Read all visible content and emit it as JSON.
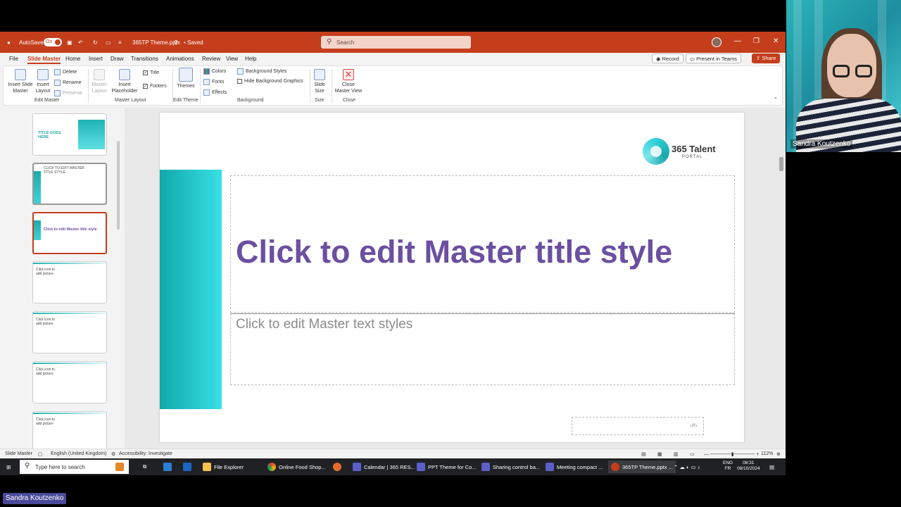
{
  "titlebar": {
    "autosave_label": "AutoSave",
    "autosave_state": "On",
    "filename": "365TP Theme.pptx",
    "saved_status": "• Saved",
    "search_placeholder": "Search"
  },
  "menu": {
    "tabs": [
      "File",
      "Slide Master",
      "Home",
      "Insert",
      "Draw",
      "Transitions",
      "Animations",
      "Review",
      "View",
      "Help"
    ],
    "record": "Record",
    "present_teams": "Present in Teams",
    "share": "Share"
  },
  "ribbon": {
    "insert_slide_master": "Insert Slide Master",
    "insert_layout": "Insert Layout",
    "delete": "Delete",
    "rename": "Rename",
    "preserve": "Preserve",
    "edit_master_group": "Edit Master",
    "master_layout": "Master Layout",
    "insert_placeholder": "Insert Placeholder",
    "title_check": "Title",
    "footers_check": "Footers",
    "master_layout_group": "Master Layout",
    "themes": "Themes",
    "edit_theme_group": "Edit Theme",
    "colors": "Colors",
    "fonts": "Fonts",
    "effects": "Effects",
    "background_styles": "Background Styles",
    "hide_bg_graphics": "Hide Background Graphics",
    "background_group": "Background",
    "slide_size": "Slide Size",
    "size_group": "Size",
    "close_master_view": "Close Master View",
    "close_group": "Close"
  },
  "thumbnails": [
    {
      "title": "TITLE GOES HERE"
    },
    {
      "title": "CLICK TO EDIT MASTER TITLE STYLE"
    },
    {
      "title": "Click to edit Master title style"
    },
    {
      "title": "Click icon to add picture"
    },
    {
      "title": "Click icon to add picture"
    },
    {
      "title": "Click icon to add picture"
    },
    {
      "title": "Click icon to add picture"
    }
  ],
  "slide": {
    "logo_main": "365 Talent",
    "logo_sub": "PORTAL",
    "title_placeholder": "Click to edit Master title style",
    "text_placeholder": "Click to edit Master text styles",
    "footer_slide_num": "‹#›"
  },
  "statusbar": {
    "view": "Slide Master",
    "language": "English (United Kingdom)",
    "accessibility": "Accessibility: Investigate",
    "zoom": "112%"
  },
  "taskbar": {
    "search_placeholder": "Type here to search",
    "apps": [
      "File Explorer",
      "Online Food Shop...",
      "Calendar | 365 RES...",
      "PPT Theme for Co...",
      "Sharing control ba...",
      "Meeting compact ...",
      "365TP Theme.pptx ..."
    ],
    "lang_top": "ENG",
    "lang_bottom": "FR",
    "time": "08:31",
    "date": "08/10/2024"
  },
  "meeting": {
    "participant": "Sandra Koutzenko",
    "self_label": "Sandra Koutzenko"
  },
  "colors": {
    "accent": "#c43e1c",
    "teal": "#1fb3b3",
    "title_purple": "#6b4fa0"
  }
}
